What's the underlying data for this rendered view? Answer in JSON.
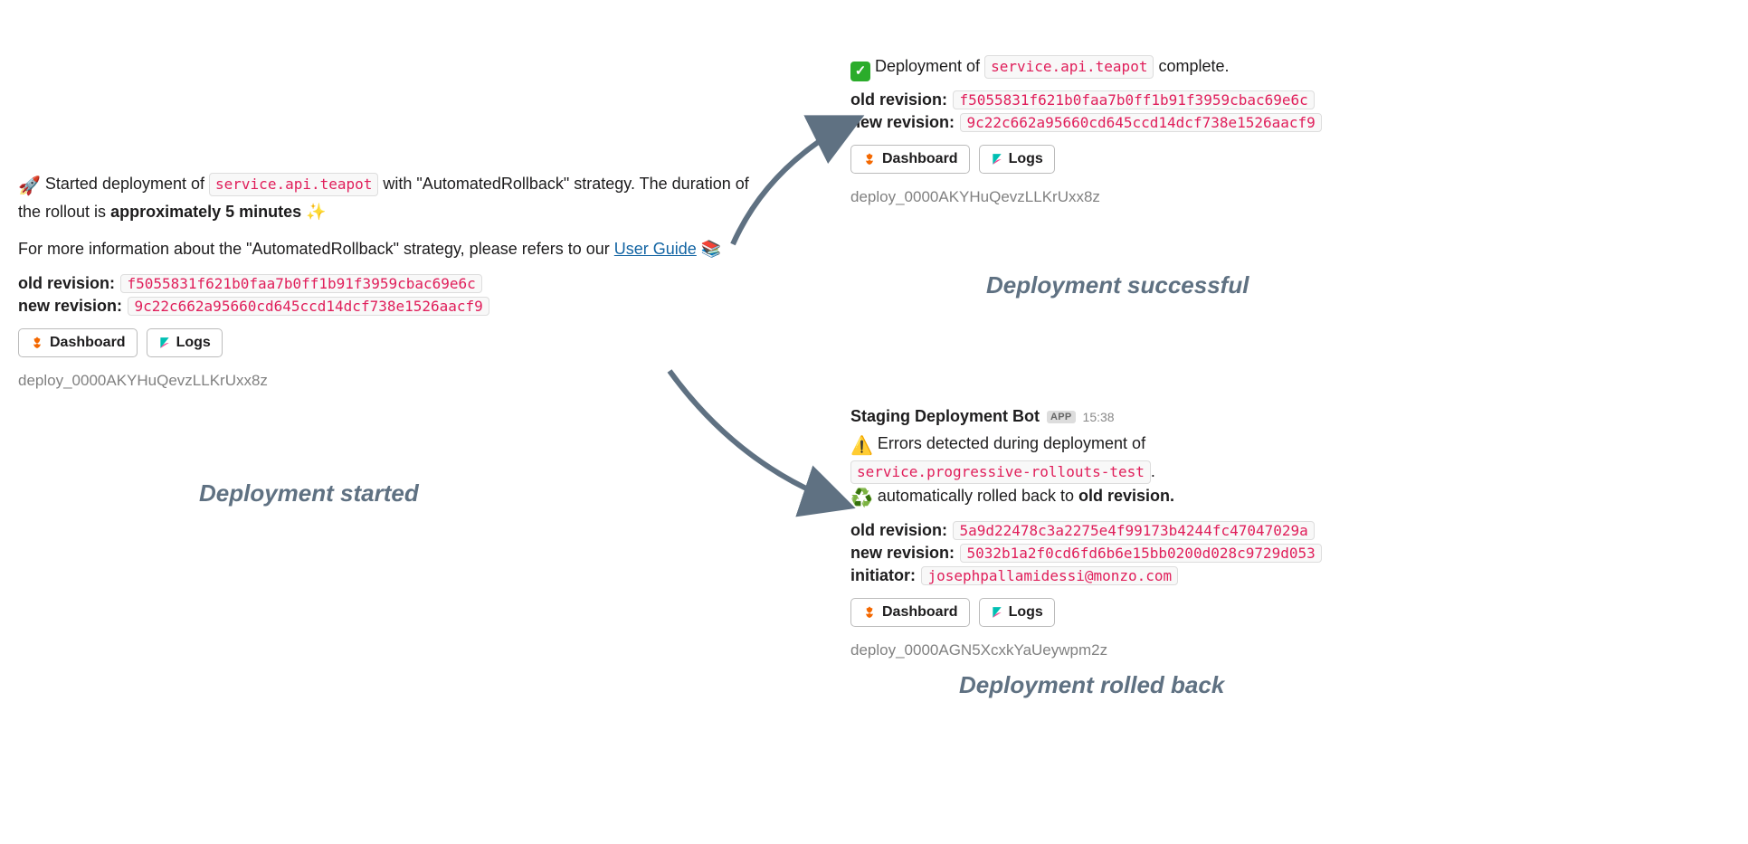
{
  "started": {
    "emoji_rocket": "🚀",
    "text_prefix": " Started deployment of ",
    "service_name": "service.api.teapot",
    "text_mid": " with \"AutomatedRollback\" strategy. The duration of the rollout is ",
    "duration_bold": "approximately 5 minutes",
    "emoji_sparkles": " ✨",
    "info_prefix": "For more information about the \"AutomatedRollback\" strategy, please refers to our ",
    "info_link": "User Guide",
    "info_link_emoji": " 📚",
    "old_label": "old revision:",
    "old_rev": "f5055831f621b0faa7b0ff1b91f3959cbac69e6c",
    "new_label": "new revision:",
    "new_rev": "9c22c662a95660cd645ccd14dcf738e1526aacf9",
    "dashboard_label": "Dashboard",
    "logs_label": "Logs",
    "deploy_id": "deploy_0000AKYHuQevzLLKrUxx8z"
  },
  "successful": {
    "text_prefix": " Deployment of ",
    "service_name": "service.api.teapot",
    "text_suffix": " complete.",
    "old_label": "old revision:",
    "old_rev": "f5055831f621b0faa7b0ff1b91f3959cbac69e6c",
    "new_label": "new revision:",
    "new_rev": "9c22c662a95660cd645ccd14dcf738e1526aacf9",
    "dashboard_label": "Dashboard",
    "logs_label": "Logs",
    "deploy_id": "deploy_0000AKYHuQevzLLKrUxx8z"
  },
  "rollback": {
    "bot_name": "Staging Deployment Bot",
    "app_badge": "APP",
    "time": "15:38",
    "emoji_warn": "⚠️",
    "error_prefix": " Errors detected during deployment of ",
    "service_name": "service.progressive-rollouts-test",
    "period": ".",
    "emoji_recycle": "♻️",
    "rolled_back_prefix": " automatically rolled back to ",
    "rolled_back_bold": "old revision.",
    "old_label": "old revision:",
    "old_rev": "5a9d22478c3a2275e4f99173b4244fc47047029a",
    "new_label": "new revision:",
    "new_rev": "5032b1a2f0cd6fd6b6e15bb0200d028c9729d053",
    "initiator_label": "initiator:",
    "initiator": "josephpallamidessi@monzo.com",
    "dashboard_label": "Dashboard",
    "logs_label": "Logs",
    "deploy_id": "deploy_0000AGN5XcxkYaUeywpm2z"
  },
  "captions": {
    "started": "Deployment started",
    "successful": "Deployment successful",
    "rollback": "Deployment rolled back"
  }
}
